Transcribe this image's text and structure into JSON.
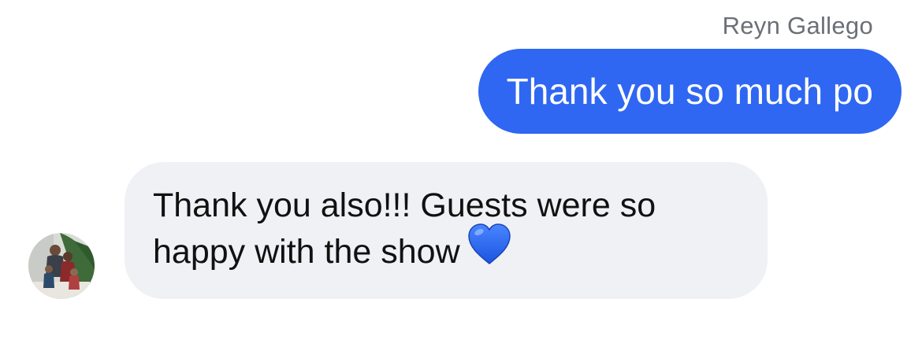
{
  "conversation": {
    "sender_name": "Reyn Gallego",
    "outgoing_message": "Thank you so much po",
    "incoming_message": {
      "line1": "Thank you also!!! Guests were so",
      "line2": "happy with the show",
      "emoji": "blue-heart-icon"
    }
  },
  "colors": {
    "outgoing_bubble": "#2f67f2",
    "incoming_bubble": "#f0f1f5",
    "heart": "#1f5fe8"
  }
}
